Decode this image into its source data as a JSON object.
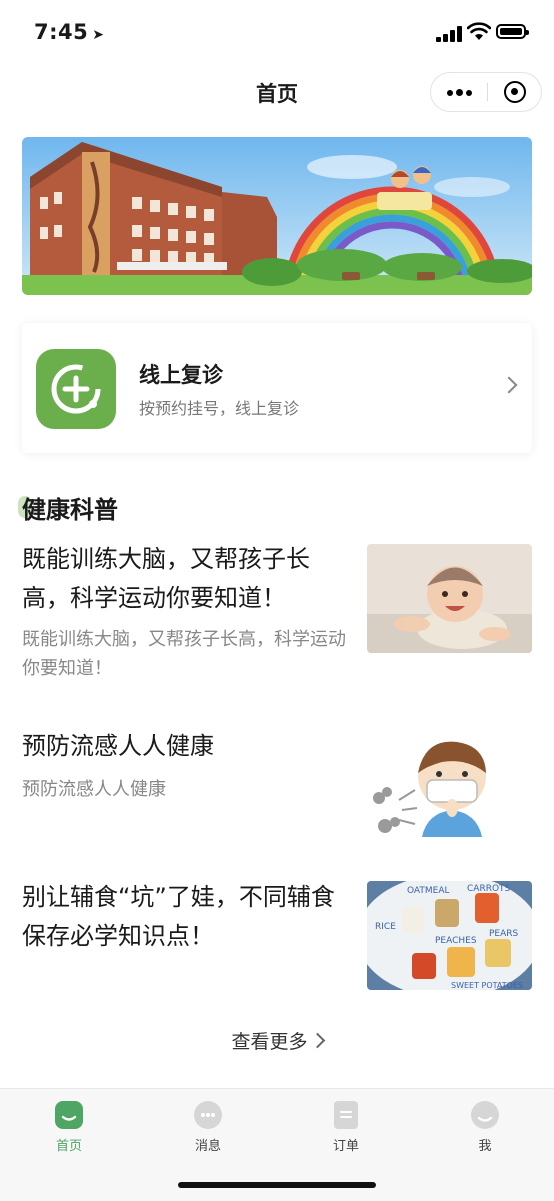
{
  "status_bar": {
    "time": "7:45",
    "location_icon": "location-arrow-icon"
  },
  "nav": {
    "title": "首页"
  },
  "service": {
    "title": "线上复诊",
    "subtitle": "按预约挂号，线上复诊"
  },
  "section": {
    "title": "健康科普"
  },
  "articles": [
    {
      "title": "既能训练大脑，又帮孩子长高，科学运动你要知道！",
      "desc": "既能训练大脑，又帮孩子长高，科学运动你要知道！"
    },
    {
      "title": "预防流感人人健康",
      "desc": "预防流感人人健康"
    },
    {
      "title": "别让辅食“坑”了娃，不同辅食保存必学知识点！",
      "desc": ""
    }
  ],
  "thumb3_labels": {
    "a": "OATMEAL",
    "b": "CARROTS",
    "c": "RICE",
    "d": "PEACHES",
    "e": "PEARS",
    "f": "SWEET POTATOES"
  },
  "more": {
    "label": "查看更多"
  },
  "tabs": [
    {
      "label": "首页",
      "icon": "home-icon"
    },
    {
      "label": "消息",
      "icon": "message-icon"
    },
    {
      "label": "订单",
      "icon": "order-icon"
    },
    {
      "label": "我",
      "icon": "profile-icon"
    }
  ],
  "colors": {
    "accent": "#4fa564",
    "service_icon": "#6aaf4c"
  }
}
